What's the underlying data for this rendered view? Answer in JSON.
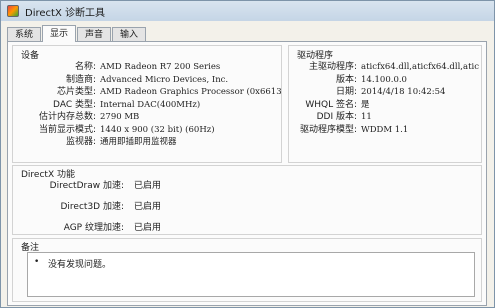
{
  "window": {
    "title": "DirectX 诊断工具"
  },
  "tabs": [
    {
      "label": "系统"
    },
    {
      "label": "显示"
    },
    {
      "label": "声音"
    },
    {
      "label": "输入"
    }
  ],
  "device": {
    "title": "设备",
    "rows": [
      {
        "label": "名称:",
        "value": "AMD Radeon R7 200 Series"
      },
      {
        "label": "制造商:",
        "value": "Advanced Micro Devices, Inc."
      },
      {
        "label": "芯片类型:",
        "value": "AMD Radeon Graphics Processor (0x6613)"
      },
      {
        "label": "DAC 类型:",
        "value": "Internal DAC(400MHz)"
      },
      {
        "label": "估计内存总数:",
        "value": "2790 MB"
      },
      {
        "label": "当前显示模式:",
        "value": "1440 x 900 (32 bit) (60Hz)"
      },
      {
        "label": "监视器:",
        "value": "通用即插即用监视器"
      }
    ]
  },
  "driver": {
    "title": "驱动程序",
    "rows": [
      {
        "label": "主驱动程序:",
        "value": "aticfx64.dll,aticfx64.dll,atic"
      },
      {
        "label": "版本:",
        "value": "14.100.0.0"
      },
      {
        "label": "日期:",
        "value": "2014/4/18 10:42:54"
      },
      {
        "label": "WHQL 签名:",
        "value": "是"
      },
      {
        "label": "DDI 版本:",
        "value": "11"
      },
      {
        "label": "驱动程序模型:",
        "value": "WDDM 1.1"
      }
    ]
  },
  "directx": {
    "title": "DirectX 功能",
    "rows": [
      {
        "label": "DirectDraw 加速:",
        "value": "已启用"
      },
      {
        "label": "Direct3D 加速:",
        "value": "已启用"
      },
      {
        "label": "AGP 纹理加速:",
        "value": "已启用"
      }
    ]
  },
  "notes": {
    "title": "备注",
    "bullet": "•",
    "items": [
      "没有发现问题。"
    ]
  }
}
